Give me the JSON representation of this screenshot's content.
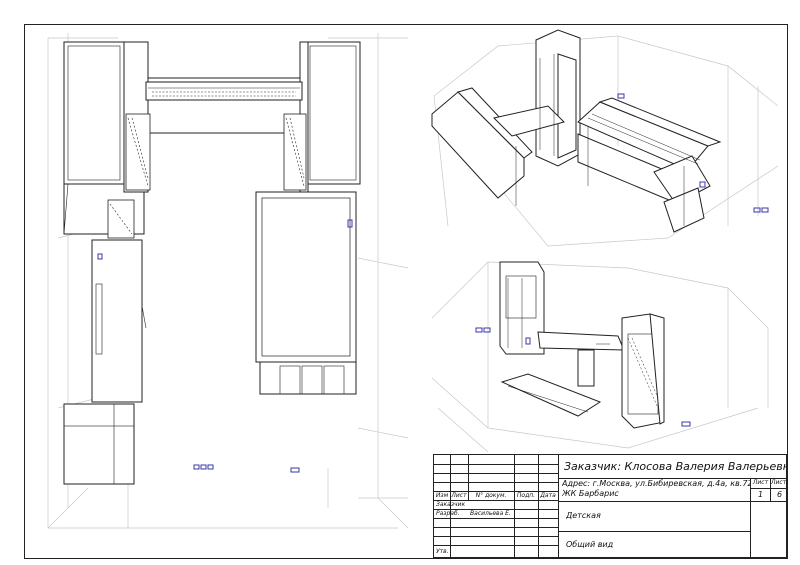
{
  "drawing": {
    "customer_line": "Заказчик: Клосова Валерия Валерьевна",
    "address_line1": "Адрес: г.Москва, ул.Бибиревская, д.4а, кв.72,",
    "address_line2": "ЖК Барбарис",
    "room": "Детская",
    "sheet_title": "Общий вид",
    "sheet_label": "Лист",
    "sheets_label": "Листов",
    "sheet_no": "1",
    "sheets_total": "6",
    "headers": [
      "Изм",
      "Лист",
      "N° докум.",
      "Подп.",
      "Дата"
    ],
    "roles": {
      "customer": "Заказчик",
      "developer": "Разраб.",
      "developer_name": "Васильева Е.",
      "approved": "Утв."
    }
  }
}
